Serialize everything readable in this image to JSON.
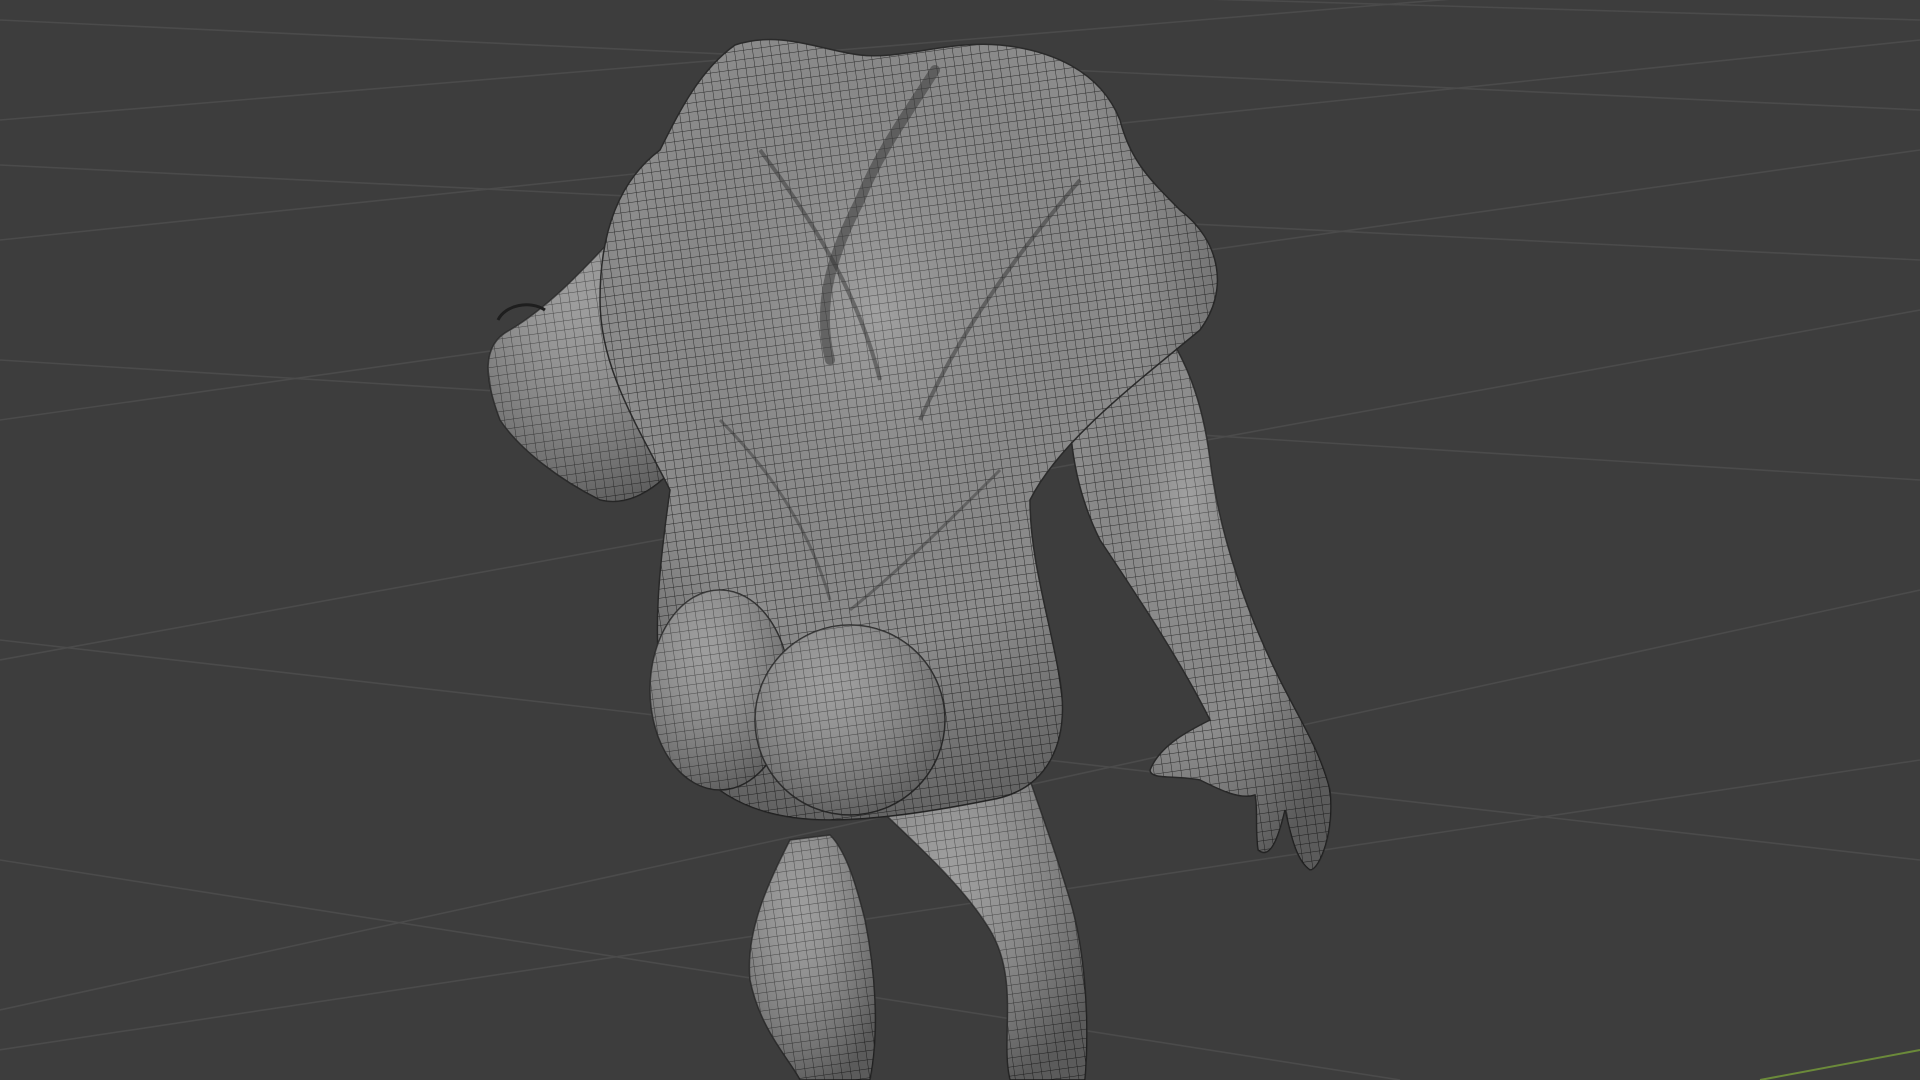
{
  "app": {
    "editor": "3d-viewport",
    "mode": "object"
  },
  "viewport": {
    "background_color": "#3d3d3d",
    "grid_line_color": "#4a4a4a",
    "x_axis_color": "#6b8a3a",
    "object": {
      "name": "",
      "shading": "solid-wireframe",
      "surface_color": "#8e8e8e",
      "wire_color": "#2b2b2b"
    }
  }
}
